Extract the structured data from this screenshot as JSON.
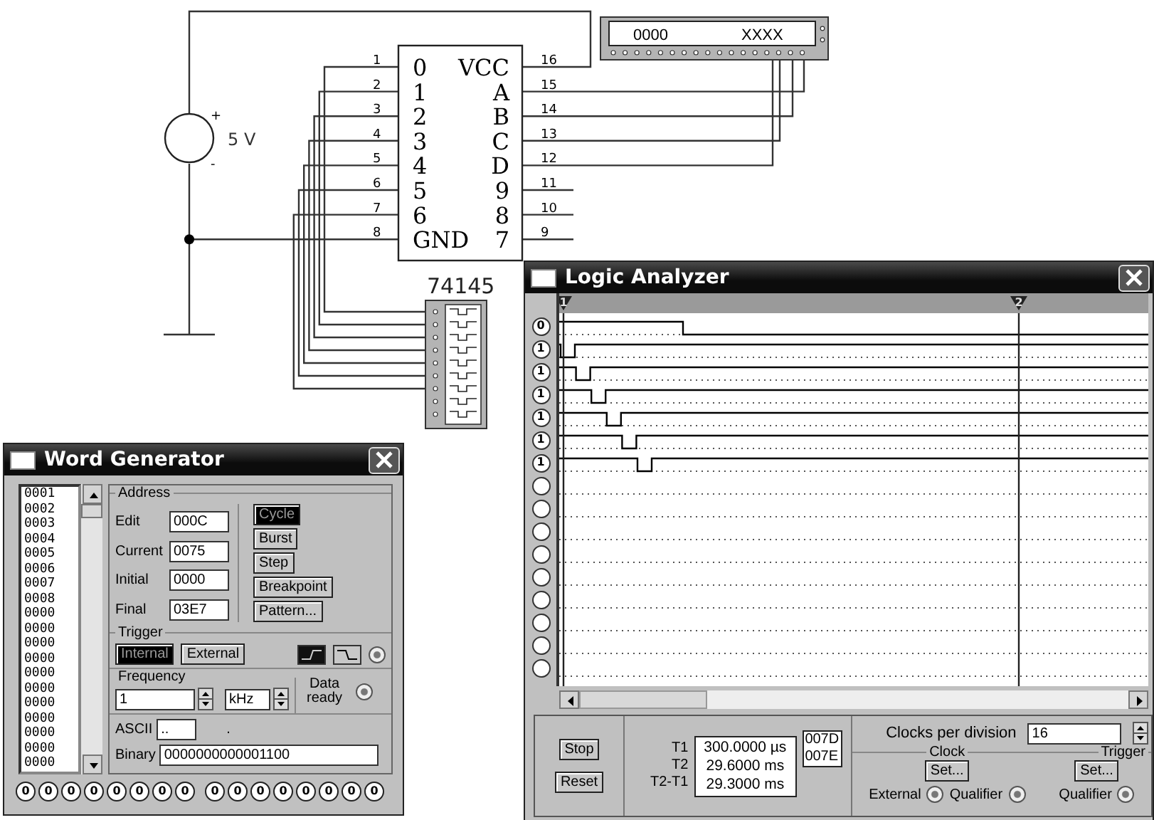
{
  "schematic": {
    "source": {
      "label": "5 V",
      "plus": "+",
      "minus": "-"
    },
    "chip": {
      "part": "74145",
      "left_pins": [
        {
          "number": "1",
          "label": "0"
        },
        {
          "number": "2",
          "label": "1"
        },
        {
          "number": "3",
          "label": "2"
        },
        {
          "number": "4",
          "label": "3"
        },
        {
          "number": "5",
          "label": "4"
        },
        {
          "number": "6",
          "label": "5"
        },
        {
          "number": "7",
          "label": "6"
        },
        {
          "number": "8",
          "label": "GND"
        }
      ],
      "right_pins": [
        {
          "number": "16",
          "label": "VCC"
        },
        {
          "number": "15",
          "label": "A"
        },
        {
          "number": "14",
          "label": "B"
        },
        {
          "number": "13",
          "label": "C"
        },
        {
          "number": "12",
          "label": "D"
        },
        {
          "number": "11",
          "label": "9"
        },
        {
          "number": "10",
          "label": "8"
        },
        {
          "number": "9",
          "label": "7"
        }
      ]
    },
    "display": {
      "readings": [
        "0000",
        "XXXX"
      ]
    }
  },
  "word_generator": {
    "title": "Word Generator",
    "words": [
      "0001",
      "0002",
      "0003",
      "0004",
      "0005",
      "0006",
      "0007",
      "0008",
      "0000",
      "0000",
      "0000",
      "0000",
      "0000",
      "0000",
      "0000",
      "0000",
      "0000",
      "0000",
      "0000"
    ],
    "address": {
      "legend": "Address",
      "fields": [
        {
          "label": "Edit",
          "value": "000C"
        },
        {
          "label": "Current",
          "value": "0075"
        },
        {
          "label": "Initial",
          "value": "0000"
        },
        {
          "label": "Final",
          "value": "03E7"
        }
      ]
    },
    "mode_buttons": [
      {
        "label": "Cycle",
        "selected": true
      },
      {
        "label": "Burst",
        "selected": false
      },
      {
        "label": "Step",
        "selected": false
      },
      {
        "label": "Breakpoint",
        "selected": false
      },
      {
        "label": "Pattern...",
        "selected": false
      }
    ],
    "trigger": {
      "legend": "Trigger",
      "sources": [
        {
          "label": "Internal",
          "selected": true
        },
        {
          "label": "External",
          "selected": false
        }
      ],
      "edges": [
        {
          "kind": "rising",
          "selected": true
        },
        {
          "kind": "falling",
          "selected": false
        }
      ],
      "terminal": {
        "checked": true
      }
    },
    "frequency": {
      "legend": "Frequency",
      "value": "1",
      "unit": "kHz"
    },
    "data_ready": {
      "label": "Data ready",
      "checked": true
    },
    "ascii": {
      "label": "ASCII",
      "value": "..",
      "note": "."
    },
    "binary": {
      "label": "Binary",
      "value": "0000000000001100"
    },
    "bits": [
      "0",
      "0",
      "0",
      "0",
      "0",
      "0",
      "0",
      "0",
      "0",
      "0",
      "0",
      "0",
      "0",
      "0",
      "0",
      "0"
    ]
  },
  "logic_analyzer": {
    "title": "Logic Analyzer",
    "cursors": [
      {
        "label": "1"
      },
      {
        "label": "2"
      }
    ],
    "channels": [
      {
        "kind": "probe",
        "reading": "0"
      },
      {
        "kind": "probe",
        "reading": "1"
      },
      {
        "kind": "probe",
        "reading": "1"
      },
      {
        "kind": "probe",
        "reading": "1"
      },
      {
        "kind": "probe",
        "reading": "1"
      },
      {
        "kind": "probe",
        "reading": "1"
      },
      {
        "kind": "probe",
        "reading": "1"
      },
      {
        "kind": "unused"
      },
      {
        "kind": "unused"
      },
      {
        "kind": "unused"
      },
      {
        "kind": "unused"
      },
      {
        "kind": "unused"
      },
      {
        "kind": "unused"
      },
      {
        "kind": "unused"
      },
      {
        "kind": "unused"
      },
      {
        "kind": "unused"
      }
    ],
    "buttons": [
      "Stop",
      "Reset"
    ],
    "times": [
      {
        "label": "T1",
        "value": "300.0000 µs",
        "address": "007D"
      },
      {
        "label": "T2",
        "value": "29.6000 ms",
        "address": "007E"
      },
      {
        "label": "T2-T1",
        "value": "29.3000 ms"
      }
    ],
    "clocks_per_division": {
      "label": "Clocks per division",
      "value": "16"
    },
    "clock": {
      "legend": "Clock",
      "button": "Set...",
      "options": [
        {
          "label": "External",
          "checked": true
        },
        {
          "label": "Qualifier",
          "checked": true
        }
      ]
    },
    "trigger": {
      "legend": "Trigger",
      "button": "Set...",
      "options": [
        {
          "label": "Qualifier",
          "checked": true
        }
      ]
    }
  }
}
